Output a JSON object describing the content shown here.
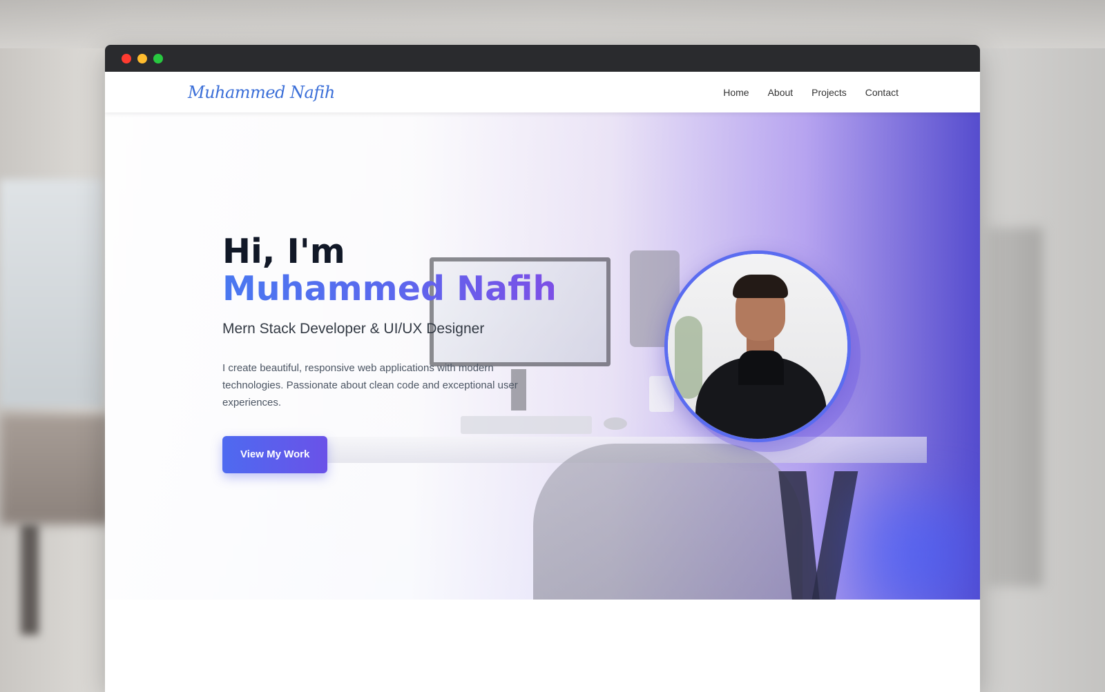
{
  "window": {
    "controls": [
      "close",
      "minimize",
      "maximize"
    ],
    "colors": {
      "close": "#ff3b30",
      "minimize": "#febc2e",
      "maximize": "#28c840"
    }
  },
  "header": {
    "logo": "Muhammed Nafih",
    "nav": [
      {
        "label": "Home"
      },
      {
        "label": "About"
      },
      {
        "label": "Projects"
      },
      {
        "label": "Contact"
      }
    ]
  },
  "hero": {
    "greeting": "Hi, I'm",
    "name": "Muhammed Nafih",
    "role": "Mern Stack Developer & UI/UX Designer",
    "description": "I create beautiful, responsive web applications with modern technologies. Passionate about clean code and exceptional user experiences.",
    "cta": "View My Work"
  },
  "colors": {
    "accent": "#4e6af0",
    "accent_end": "#6a52e8",
    "logo": "#3b6fd8"
  }
}
